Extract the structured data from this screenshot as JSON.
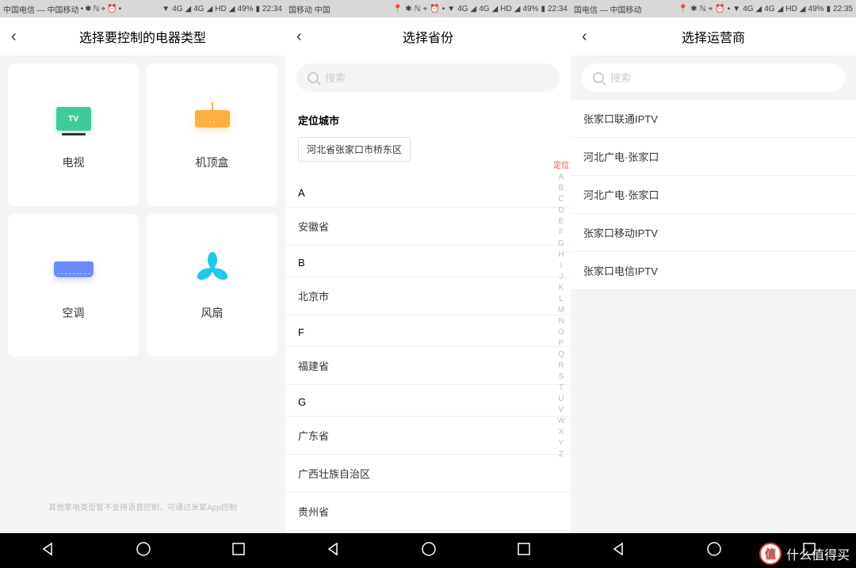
{
  "status": {
    "carrier1": "中国电信 — 中国移动",
    "carrier2": "国移动           中国",
    "carrier3": "国电信 — 中国移动",
    "net": "4G",
    "hd": "HD",
    "battery": "49%",
    "time1": "22:34",
    "time2": "22:34",
    "time3": "22:35"
  },
  "screen1": {
    "title": "选择要控制的电器类型",
    "cards": [
      {
        "label": "电视",
        "icon_text": "TV"
      },
      {
        "label": "机顶盒"
      },
      {
        "label": "空调"
      },
      {
        "label": "风扇"
      }
    ],
    "footnote": "其他家电类型暂不支持语音控制，可通过米家App控制"
  },
  "screen2": {
    "title": "选择省份",
    "search_placeholder": "搜索",
    "location_label": "定位城市",
    "location_chip": "河北省张家口市桥东区",
    "sections": [
      {
        "letter": "A",
        "items": [
          "安徽省"
        ]
      },
      {
        "letter": "B",
        "items": [
          "北京市"
        ]
      },
      {
        "letter": "F",
        "items": [
          "福建省"
        ]
      },
      {
        "letter": "G",
        "items": [
          "广东省",
          "广西壮族自治区",
          "贵州省"
        ]
      }
    ],
    "index_top": "定位",
    "index": [
      "A",
      "B",
      "C",
      "D",
      "E",
      "F",
      "G",
      "H",
      "I",
      "J",
      "K",
      "L",
      "M",
      "N",
      "O",
      "P",
      "Q",
      "R",
      "S",
      "T",
      "U",
      "V",
      "W",
      "X",
      "Y",
      "Z"
    ]
  },
  "screen3": {
    "title": "选择运营商",
    "search_placeholder": "搜索",
    "operators": [
      "张家口联通IPTV",
      "河北广电·张家口",
      "河北广电·张家口",
      "张家口移动IPTV",
      "张家口电信IPTV"
    ]
  },
  "watermark": {
    "badge": "值",
    "text": "什么值得买"
  }
}
